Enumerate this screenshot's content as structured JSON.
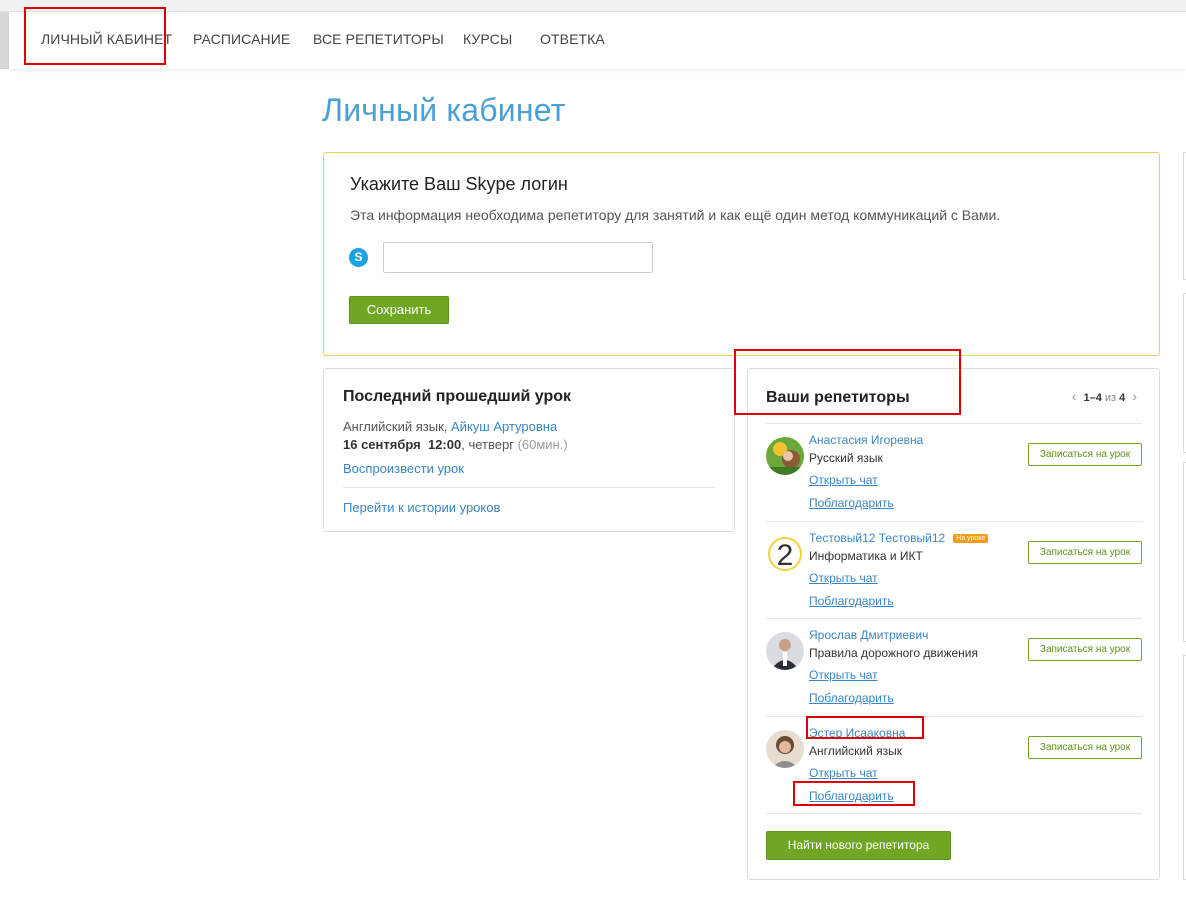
{
  "nav": {
    "items": [
      "ЛИЧНЫЙ КАБИНЕТ",
      "РАСПИСАНИЕ",
      "ВСЕ РЕПЕТИТОРЫ",
      "КУРСЫ",
      "ОТВЕТКА"
    ]
  },
  "page": {
    "title": "Личный кабинет"
  },
  "skype": {
    "title": "Укажите Ваш Skype логин",
    "description": "Эта информация необходима репетитору для занятий и как ещё один метод коммуникаций с Вами.",
    "input_value": "",
    "save_label": "Сохранить",
    "icon": "skype-icon"
  },
  "last_lesson": {
    "title": "Последний прошедший урок",
    "subject": "Английский язык,",
    "tutor": "Айкуш Артуровна",
    "date": "16 сентября",
    "time": "12:00",
    "weekday": ", четверг",
    "duration": "(60мин.)",
    "replay_label": "Воспроизвести урок",
    "history_label": "Перейти к истории уроков"
  },
  "tutors": {
    "title": "Ваши репетиторы",
    "pager": {
      "range": "1–4",
      "of": "из",
      "total": "4"
    },
    "book_label": "Записаться на урок",
    "chat_label": "Открыть чат",
    "thank_label": "Поблагодарить",
    "find_label": "Найти нового репетитора",
    "list": [
      {
        "name": "Анастасия Игоревна",
        "subject": "Русский язык",
        "badge": ""
      },
      {
        "name": "Тестовый12 Тестовый12",
        "subject": "Информатика и ИКТ",
        "badge": "На уроке"
      },
      {
        "name": "Ярослав Дмитриевич",
        "subject": "Правила дорожного движения",
        "badge": ""
      },
      {
        "name": "Эстер Исааковна",
        "subject": "Английский язык",
        "badge": ""
      }
    ]
  },
  "colors": {
    "accent": "#4a9fd8",
    "button_green": "#6fa722",
    "link": "#3a85c6",
    "highlight": "#e10000",
    "skype_border": "#f2d04f"
  }
}
